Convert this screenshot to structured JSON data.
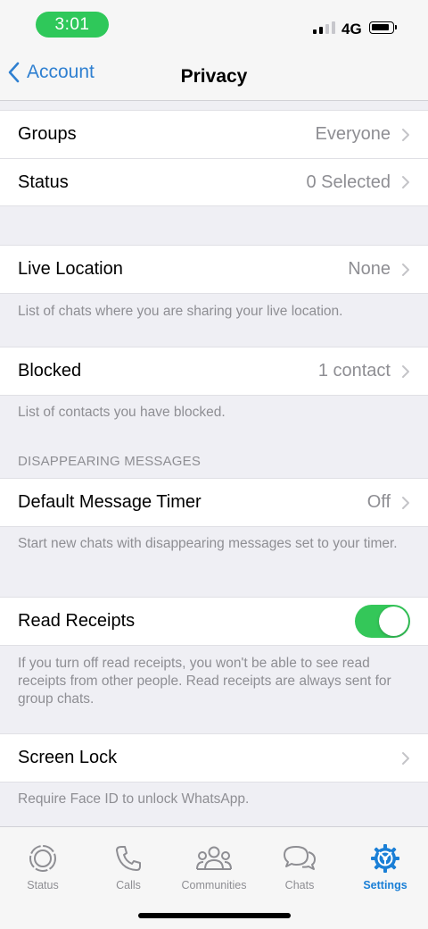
{
  "status_bar": {
    "time": "3:01",
    "network": "4G"
  },
  "nav": {
    "back_label": "Account",
    "title": "Privacy"
  },
  "rows": {
    "groups": {
      "label": "Groups",
      "value": "Everyone"
    },
    "status": {
      "label": "Status",
      "value": "0 Selected"
    },
    "live_location": {
      "label": "Live Location",
      "value": "None",
      "footer": "List of chats where you are sharing your live location."
    },
    "blocked": {
      "label": "Blocked",
      "value": "1 contact",
      "footer": "List of contacts you have blocked."
    },
    "disappearing": {
      "header": "DISAPPEARING MESSAGES",
      "label": "Default Message Timer",
      "value": "Off",
      "footer": "Start new chats with disappearing messages set to your timer."
    },
    "read_receipts": {
      "label": "Read Receipts",
      "enabled": true,
      "footer": "If you turn off read receipts, you won't be able to see read receipts from other people. Read receipts are always sent for group chats."
    },
    "screen_lock": {
      "label": "Screen Lock",
      "footer": "Require Face ID to unlock WhatsApp."
    }
  },
  "tabs": [
    {
      "label": "Status",
      "icon": "status-icon"
    },
    {
      "label": "Calls",
      "icon": "phone-icon"
    },
    {
      "label": "Communities",
      "icon": "communities-icon"
    },
    {
      "label": "Chats",
      "icon": "chats-icon"
    },
    {
      "label": "Settings",
      "icon": "settings-icon",
      "active": true
    }
  ],
  "colors": {
    "accent": "#1a7fd6",
    "toggle_on": "#34c759",
    "time_pill": "#2fc85a"
  }
}
